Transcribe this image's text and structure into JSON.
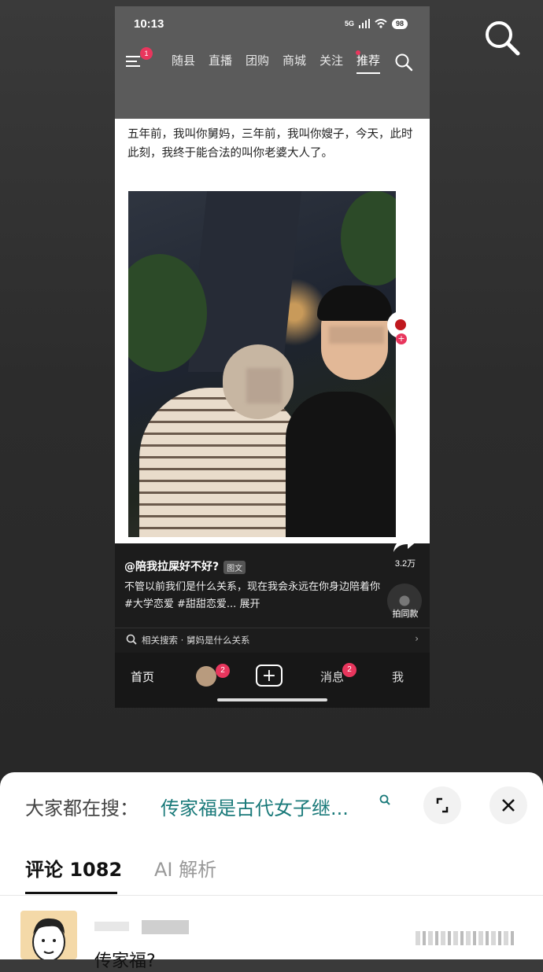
{
  "phone": {
    "status": {
      "time": "10:13",
      "signal": "5G",
      "battery": "98"
    },
    "menu_badge": "1",
    "nav_tabs": [
      "随县",
      "直播",
      "团购",
      "商城",
      "关注",
      "推荐"
    ],
    "post": {
      "text": "五年前，我叫你舅妈，三年前，我叫你嫂子，今天，此时此刻，我终于能合法的叫你老婆大人了。",
      "author": "@陪我拉屎好不好?",
      "type_tag": "图文",
      "caption": "不管以前我们是什么关系，现在我会永远在你身边陪着你#大学恋爱 #甜甜恋爱... 展开",
      "share_count": "3.2万",
      "music_label": "拍同款",
      "related_search": "相关搜索 · 舅妈是什么关系"
    },
    "tabbar": {
      "home": "首页",
      "friend_badge": "2",
      "plus": "+",
      "messages": "消息",
      "messages_badge": "2",
      "me": "我"
    }
  },
  "sheet": {
    "search_prefix": "大家都在搜：",
    "search_query": "传家福是古代女子继...",
    "tabs": {
      "comments": "评论 1082",
      "ai": "AI 解析"
    },
    "comment_text": "传家福?"
  },
  "colors": {
    "accent_pink": "#e8365d",
    "search_teal": "#1a7a7a"
  }
}
